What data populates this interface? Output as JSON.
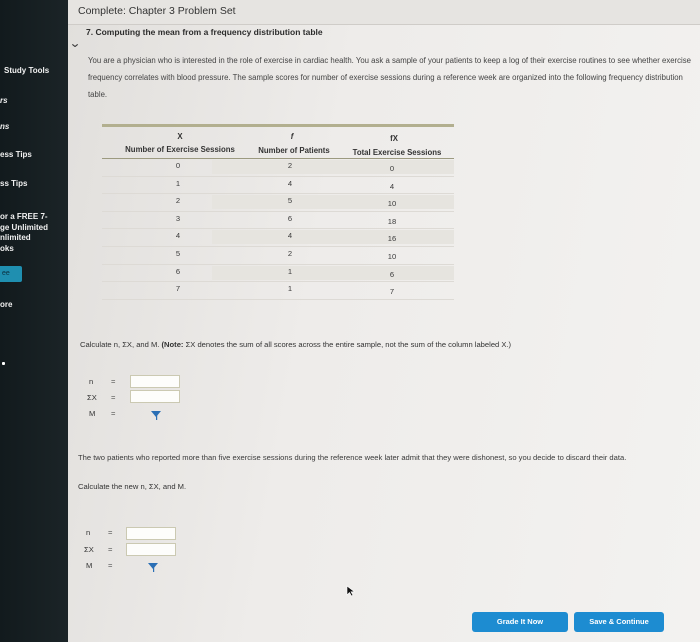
{
  "sidebar": {
    "items": [
      "Study Tools",
      "rs",
      "ns",
      "ess Tips",
      "ss Tips"
    ],
    "promo": [
      "or a FREE 7-",
      "ge Unlimited",
      "nlimited",
      "oks"
    ],
    "button": "ee",
    "more": "ore"
  },
  "header": {
    "title": "Complete: Chapter 3 Problem Set"
  },
  "problem": {
    "title": "7. Computing the mean from a frequency distribution table",
    "intro": "You are a physician who is interested in the role of exercise in cardiac health. You ask a sample of your patients to keep a log of their exercise routines to see whether exercise frequency correlates with blood pressure. The sample scores for number of exercise sessions during a reference week are organized into the following frequency distribution table."
  },
  "table": {
    "headers": [
      {
        "symbol": "X",
        "label": "Number of Exercise Sessions"
      },
      {
        "symbol": "f",
        "label": "Number of Patients"
      },
      {
        "symbol": "fX",
        "label": "Total Exercise Sessions"
      }
    ],
    "rows": [
      [
        "0",
        "2",
        "0"
      ],
      [
        "1",
        "4",
        "4"
      ],
      [
        "2",
        "5",
        "10"
      ],
      [
        "3",
        "6",
        "18"
      ],
      [
        "4",
        "4",
        "16"
      ],
      [
        "5",
        "2",
        "10"
      ],
      [
        "6",
        "1",
        "6"
      ],
      [
        "7",
        "1",
        "7"
      ]
    ]
  },
  "question1": {
    "instruction": "Calculate n, ΣX, and M.",
    "note_label": "(Note:",
    "note_text": "ΣX denotes the sum of all scores across the entire sample, not the sum of the column labeled X.)",
    "labels": [
      "n",
      "ΣX",
      "M"
    ],
    "eq": "="
  },
  "question2": {
    "note": "The two patients who reported more than five exercise sessions during the reference week later admit that they were dishonest, so you decide to discard their data.",
    "instruction": "Calculate the new n, ΣX, and M.",
    "labels": [
      "n",
      "ΣX",
      "M"
    ],
    "eq": "="
  },
  "buttons": {
    "grade": "Grade It Now",
    "save": "Save & Continue"
  },
  "colors": {
    "accent": "#1d8cd1",
    "sidebar": "#161e21"
  }
}
